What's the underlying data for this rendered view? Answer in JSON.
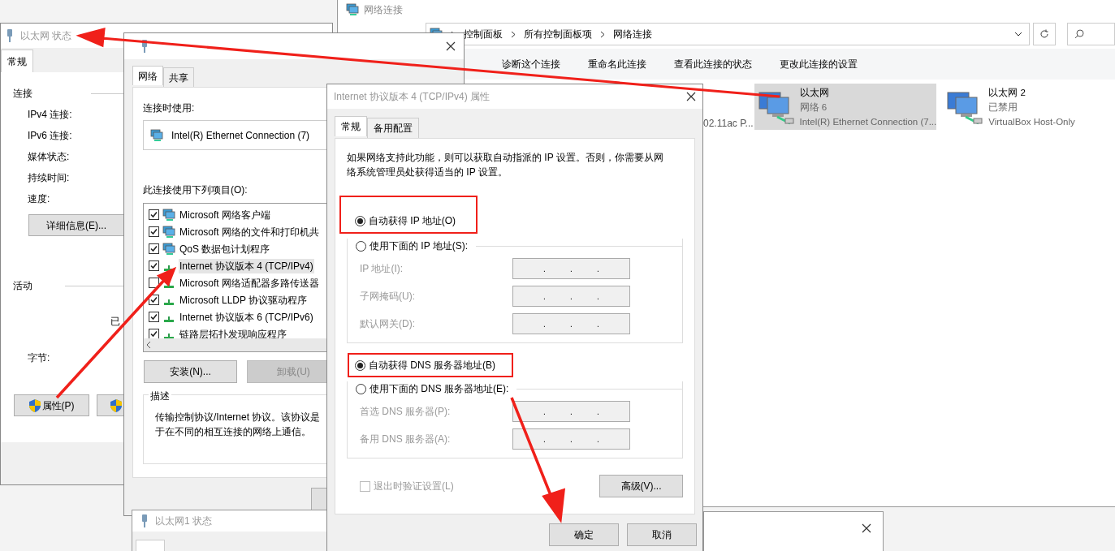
{
  "status_window": {
    "title": "以太网 状态",
    "tabs": [
      {
        "label": "常规",
        "selected": true
      }
    ],
    "section_connection": "连接",
    "fields": [
      "IPv4 连接:",
      "IPv6 连接:",
      "媒体状态:",
      "持续时间:",
      "速度:"
    ],
    "details_button": "详细信息(E)...",
    "section_activity": "活动",
    "sent_label": "已",
    "bytes_label": "字节:",
    "properties_button": "属性(P)"
  },
  "properties_window": {
    "tabs": [
      {
        "label": "网络",
        "selected": true
      },
      {
        "label": "共享",
        "selected": false
      }
    ],
    "connect_using_label": "连接时使用:",
    "adapter": "Intel(R) Ethernet Connection (7)",
    "items_label": "此连接使用下列项目(O):",
    "items": [
      {
        "label": "Microsoft 网络客户端",
        "checked": true,
        "selected": false,
        "kind": "computer"
      },
      {
        "label": "Microsoft 网络的文件和打印机共",
        "checked": true,
        "selected": false,
        "kind": "computer"
      },
      {
        "label": "QoS 数据包计划程序",
        "checked": true,
        "selected": false,
        "kind": "computer"
      },
      {
        "label": "Internet 协议版本 4 (TCP/IPv4)",
        "checked": true,
        "selected": true,
        "kind": "protocol"
      },
      {
        "label": "Microsoft 网络适配器多路传送器",
        "checked": false,
        "selected": false,
        "kind": "protocol"
      },
      {
        "label": "Microsoft LLDP 协议驱动程序",
        "checked": true,
        "selected": false,
        "kind": "protocol"
      },
      {
        "label": "Internet 协议版本 6 (TCP/IPv6)",
        "checked": true,
        "selected": false,
        "kind": "protocol"
      },
      {
        "label": "链路层拓扑发现响应程序",
        "checked": true,
        "selected": false,
        "kind": "protocol"
      }
    ],
    "install_button": "安装(N)...",
    "uninstall_button": {
      "label": "卸载(U)",
      "disabled": true
    },
    "description_label": "描述",
    "description": [
      "传输控制协议/Internet 协议。该协议是",
      "于在不同的相互连接的网络上通信。"
    ]
  },
  "explorer": {
    "title": "网络连接",
    "breadcrumb": [
      "控制面板",
      "所有控制面板项",
      "网络连接"
    ],
    "toolbar": [
      "诊断这个连接",
      "重命名此连接",
      "查看此连接的状态",
      "更改此连接的设置"
    ],
    "partial_item": "02.11ac P...",
    "connections": [
      {
        "name": "以太网",
        "network": "网络 6",
        "device": "Intel(R) Ethernet Connection (7...",
        "selected": true
      },
      {
        "name": "以太网 2",
        "network": "已禁用",
        "device": "VirtualBox Host-Only",
        "selected": false
      }
    ]
  },
  "tcp_dialog": {
    "title": "Internet 协议版本 4 (TCP/IPv4) 属性",
    "tabs": [
      {
        "label": "常规",
        "selected": true
      },
      {
        "label": "备用配置",
        "selected": false
      }
    ],
    "intro": "如果网络支持此功能，则可以获取自动指派的 IP 设置。否则，你需要从网络系统管理员处获得适当的 IP 设置。",
    "ip_options": [
      {
        "label": "自动获得 IP 地址(O)",
        "selected": true
      },
      {
        "label": "使用下面的 IP 地址(S):",
        "selected": false
      }
    ],
    "ip_fields": [
      {
        "label": "IP 地址(I):",
        "disabled": true,
        "separators": [
          ".",
          ".",
          "."
        ]
      },
      {
        "label": "子网掩码(U):",
        "disabled": true,
        "separators": [
          ".",
          ".",
          "."
        ]
      },
      {
        "label": "默认网关(D):",
        "disabled": true,
        "separators": [
          ".",
          ".",
          "."
        ]
      }
    ],
    "dns_options": [
      {
        "label": "自动获得 DNS 服务器地址(B)",
        "selected": true
      },
      {
        "label": "使用下面的 DNS 服务器地址(E):",
        "selected": false
      }
    ],
    "dns_fields": [
      {
        "label": "首选 DNS 服务器(P):",
        "disabled": true,
        "separators": [
          ".",
          ".",
          "."
        ]
      },
      {
        "label": "备用 DNS 服务器(A):",
        "disabled": true,
        "separators": [
          ".",
          ".",
          "."
        ]
      }
    ],
    "validate_checkbox": {
      "label": "退出时验证设置(L)",
      "checked": false,
      "disabled": true
    },
    "advanced_button": "高级(V)...",
    "buttons": [
      "确定",
      "取消"
    ]
  },
  "background_window": {
    "title": "以太网1 状态"
  }
}
